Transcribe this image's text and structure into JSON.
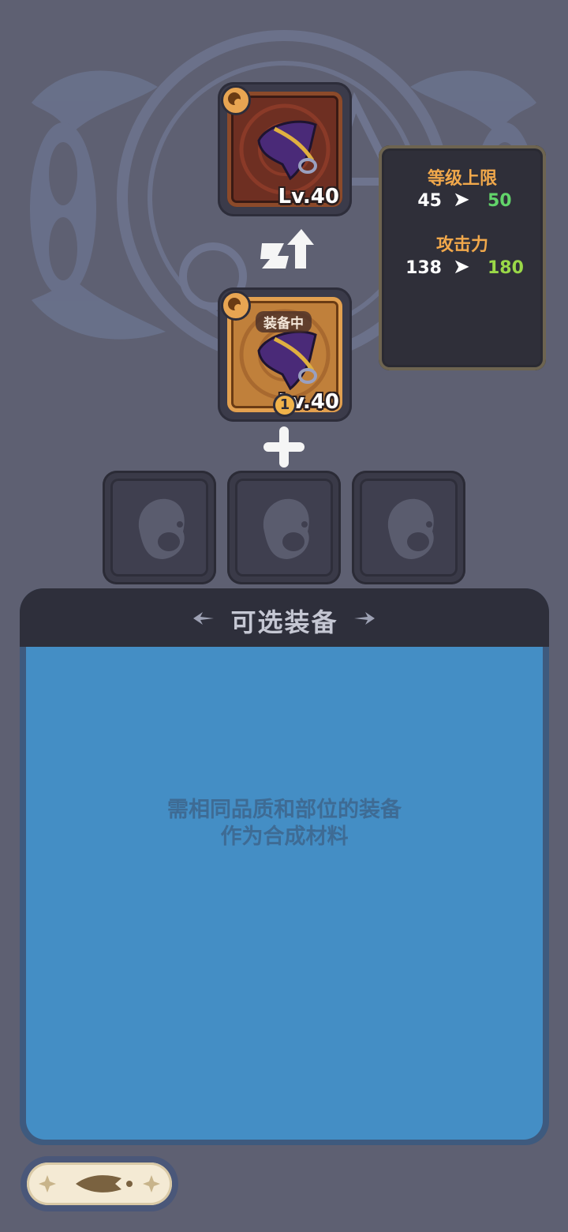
{
  "upgrade": {
    "result_item": {
      "level": "Lv.40",
      "icon": "cape-icon",
      "type_icon": "accessory-type-icon"
    },
    "current_item": {
      "level": "Lv.40",
      "equipped_tag": "装备中",
      "count": "1",
      "icon": "cape-icon",
      "type_icon": "accessory-type-icon"
    },
    "arrow_icon": "upgrade-arrow-icon",
    "plus_icon": "plus-icon"
  },
  "stats": {
    "items": [
      {
        "label": "等级上限",
        "old": "45",
        "new": "50",
        "new_color": "#62d46a"
      },
      {
        "label": "攻击力",
        "old": "138",
        "new": "180",
        "new_color": "#9ad848"
      }
    ]
  },
  "material_slots": [
    {
      "icon": "accessory-placeholder-icon"
    },
    {
      "icon": "accessory-placeholder-icon"
    },
    {
      "icon": "accessory-placeholder-icon"
    }
  ],
  "list": {
    "title": "可选装备",
    "hint_line1": "需相同品质和部位的装备",
    "hint_line2": "作为合成材料"
  },
  "back_button": {
    "icon": "back-arrow-icon"
  },
  "colors": {
    "background": "#5e6072",
    "accent": "#f1a84b",
    "list_body": "#448ec5"
  }
}
